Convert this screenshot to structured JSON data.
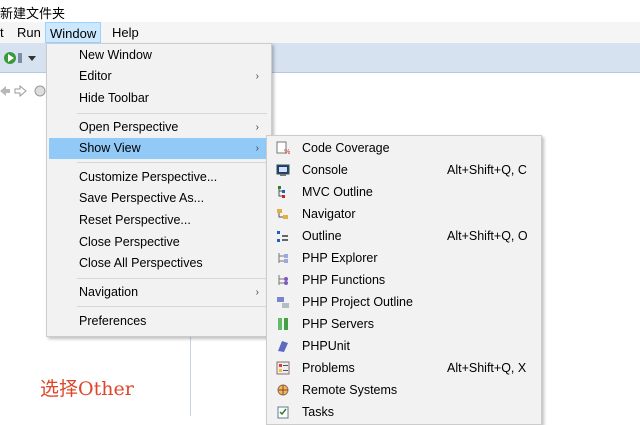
{
  "window_title": "新建文件夹",
  "menubar": {
    "items": [
      {
        "label": "t"
      },
      {
        "label": "Run"
      },
      {
        "label": "Window"
      },
      {
        "label": "Help"
      }
    ]
  },
  "window_menu": {
    "items": [
      {
        "label": "New Window"
      },
      {
        "label": "Editor",
        "submenu": true
      },
      {
        "label": "Hide Toolbar"
      },
      {
        "label": "Open Perspective",
        "submenu": true
      },
      {
        "label": "Show View",
        "submenu": true,
        "highlighted": true
      },
      {
        "label": "Customize Perspective..."
      },
      {
        "label": "Save Perspective As..."
      },
      {
        "label": "Reset Perspective..."
      },
      {
        "label": "Close Perspective"
      },
      {
        "label": "Close All Perspectives"
      },
      {
        "label": "Navigation",
        "submenu": true
      },
      {
        "label": "Preferences"
      }
    ],
    "arrow_glyph": "›"
  },
  "show_view_menu": {
    "items": [
      {
        "label": "Code Coverage",
        "shortcut": "",
        "icon": "code-coverage-icon"
      },
      {
        "label": "Console",
        "shortcut": "Alt+Shift+Q, C",
        "icon": "console-icon"
      },
      {
        "label": "MVC Outline",
        "shortcut": "",
        "icon": "mvc-outline-icon"
      },
      {
        "label": "Navigator",
        "shortcut": "",
        "icon": "navigator-icon"
      },
      {
        "label": "Outline",
        "shortcut": "Alt+Shift+Q, O",
        "icon": "outline-icon"
      },
      {
        "label": "PHP Explorer",
        "shortcut": "",
        "icon": "php-explorer-icon"
      },
      {
        "label": "PHP Functions",
        "shortcut": "",
        "icon": "php-functions-icon"
      },
      {
        "label": "PHP Project Outline",
        "shortcut": "",
        "icon": "php-project-outline-icon"
      },
      {
        "label": "PHP Servers",
        "shortcut": "",
        "icon": "php-servers-icon"
      },
      {
        "label": "PHPUnit",
        "shortcut": "",
        "icon": "phpunit-icon"
      },
      {
        "label": "Problems",
        "shortcut": "Alt+Shift+Q, X",
        "icon": "problems-icon"
      },
      {
        "label": "Remote Systems",
        "shortcut": "",
        "icon": "remote-systems-icon"
      },
      {
        "label": "Tasks",
        "shortcut": "",
        "icon": "tasks-icon"
      }
    ]
  },
  "annotation": {
    "text": "选择Other",
    "color": "#e0452b"
  },
  "colors": {
    "toolbar_bg": "#d6e2f0",
    "highlight": "#91c9f7",
    "menu_bg": "#f2f2f2",
    "menubar_active": "#cce8ff"
  }
}
